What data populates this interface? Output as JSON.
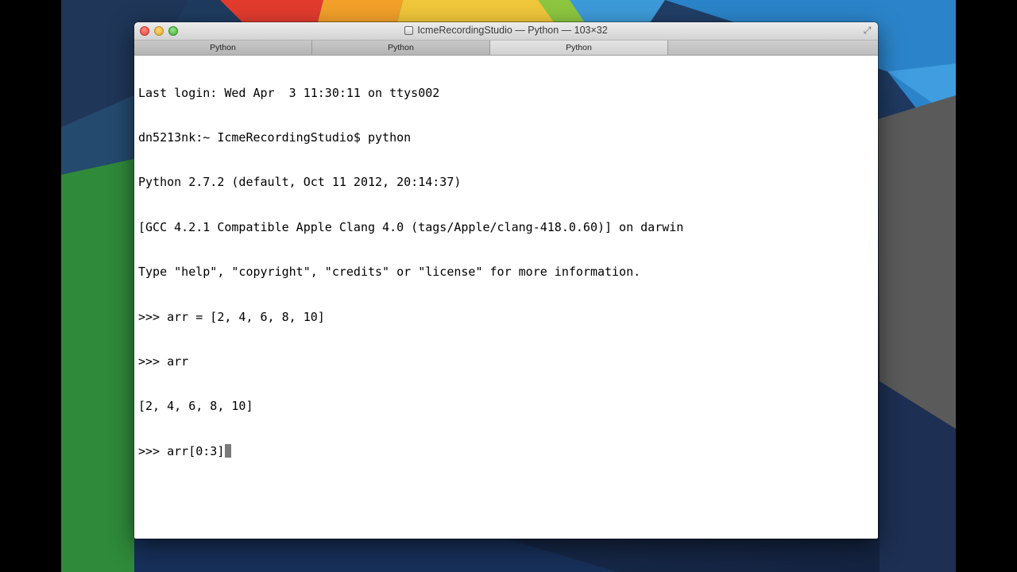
{
  "window": {
    "title": "IcmeRecordingStudio — Python — 103×32"
  },
  "tabs": [
    {
      "label": "Python",
      "active": false
    },
    {
      "label": "Python",
      "active": false
    },
    {
      "label": "Python",
      "active": true
    }
  ],
  "terminal": {
    "lines": [
      "Last login: Wed Apr  3 11:30:11 on ttys002",
      "dn5213nk:~ IcmeRecordingStudio$ python",
      "Python 2.7.2 (default, Oct 11 2012, 20:14:37)",
      "[GCC 4.2.1 Compatible Apple Clang 4.0 (tags/Apple/clang-418.0.60)] on darwin",
      "Type \"help\", \"copyright\", \"credits\" or \"license\" for more information.",
      ">>> arr = [2, 4, 6, 8, 10]",
      ">>> arr",
      "[2, 4, 6, 8, 10]"
    ],
    "current_input": ">>> arr[0:3]"
  },
  "icons": {
    "close": "close-icon",
    "minimize": "minimize-icon",
    "zoom": "zoom-icon",
    "fullscreen": "fullscreen-icon",
    "title": "terminal-icon"
  }
}
